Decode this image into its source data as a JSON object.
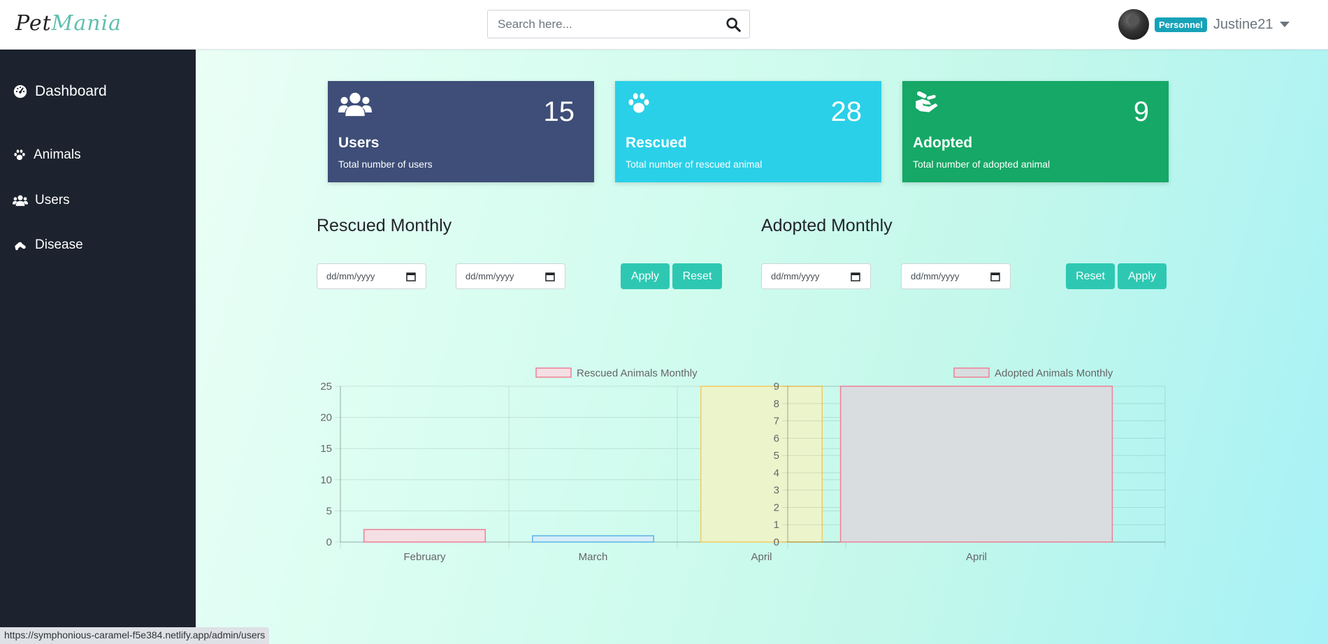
{
  "header": {
    "logo_part1": "Pet",
    "logo_part2": "Mania",
    "search_placeholder": "Search here...",
    "role_badge": "Personnel",
    "username": "Justine21"
  },
  "sidebar": {
    "items": [
      {
        "label": "Dashboard",
        "icon": "dashboard-icon"
      },
      {
        "label": "Animals",
        "icon": "paw-icon"
      },
      {
        "label": "Users",
        "icon": "users-icon"
      },
      {
        "label": "Disease",
        "icon": "disease-icon"
      }
    ]
  },
  "cards": [
    {
      "title": "Users",
      "value": "15",
      "description": "Total number of users",
      "color": "#3e4e78",
      "icon": "users-icon"
    },
    {
      "title": "Rescued",
      "value": "28",
      "description": "Total number of rescued animal",
      "color": "#2ad0e8",
      "icon": "paw-icon"
    },
    {
      "title": "Adopted",
      "value": "9",
      "description": "Total number of adopted animal",
      "color": "#15a866",
      "icon": "hand-icon"
    }
  ],
  "rescued_section": {
    "title": "Rescued Monthly",
    "date_from": "dd/mm/yyyy",
    "date_to": "dd/mm/yyyy",
    "apply_label": "Apply",
    "reset_label": "Reset"
  },
  "adopted_section": {
    "title": "Adopted Monthly",
    "date_from": "dd/mm/yyyy",
    "date_to": "dd/mm/yyyy",
    "reset_label": "Reset",
    "apply_label": "Apply"
  },
  "chart_data": [
    {
      "type": "bar",
      "legend": "Rescued Animals Monthly",
      "categories": [
        "February",
        "March",
        "April"
      ],
      "values": [
        2,
        1,
        25
      ],
      "ylim": [
        0,
        25
      ],
      "yticks": [
        0,
        5,
        10,
        15,
        20,
        25
      ],
      "bar_fill": [
        "#f4e0e4",
        "#d6eef8",
        "#ecf4cc"
      ],
      "bar_stroke": [
        "#ef7f95",
        "#5ab4e6",
        "#f4cc5f"
      ],
      "grid": true
    },
    {
      "type": "bar",
      "legend": "Adopted Animals Monthly",
      "categories": [
        "April"
      ],
      "values": [
        9
      ],
      "ylim": [
        0,
        9
      ],
      "yticks": [
        0,
        1,
        2,
        3,
        4,
        5,
        6,
        7,
        8,
        9
      ],
      "bar_fill": [
        "#d9dde0"
      ],
      "bar_stroke": [
        "#ef7f95"
      ],
      "grid": true
    }
  ],
  "status_bar": {
    "url": "https://symphonious-caramel-f5e384.netlify.app/admin/users"
  }
}
